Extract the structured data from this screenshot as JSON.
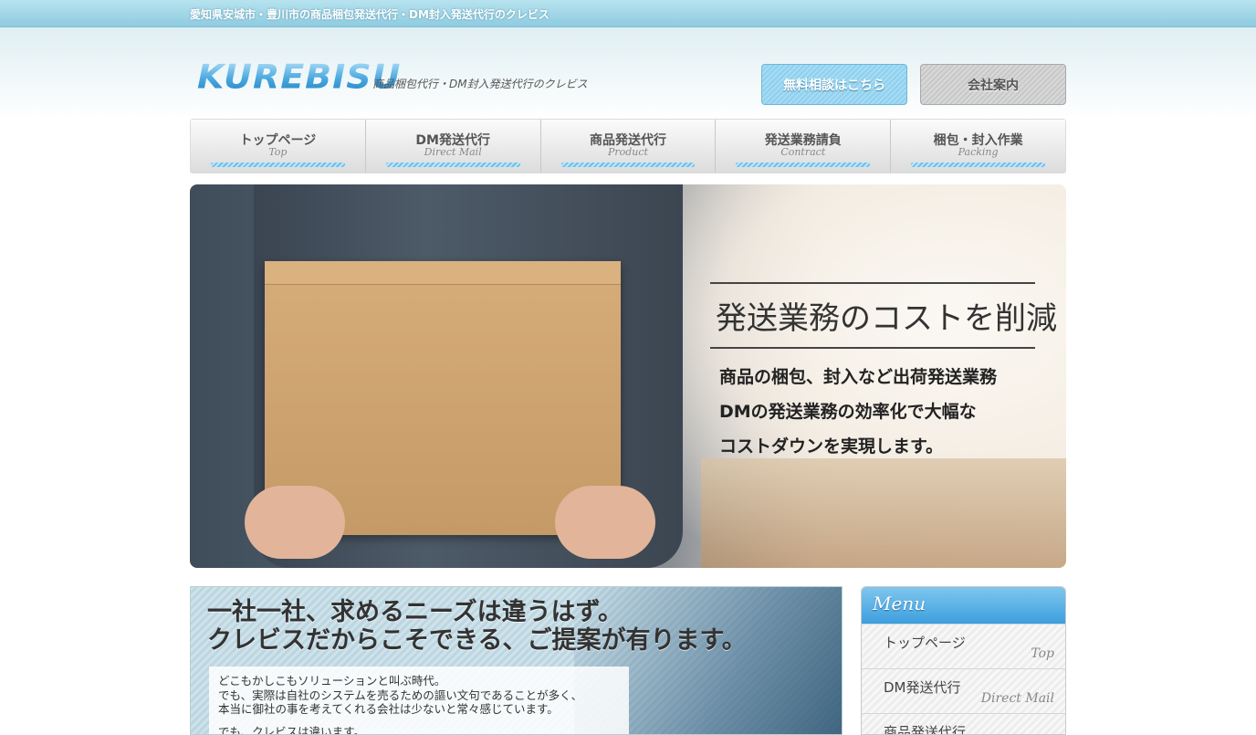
{
  "topbar": {
    "text": "愛知県安城市・豊川市の商品梱包発送代行・DM封入発送代行のクレビス"
  },
  "header": {
    "logo": "KUREBISU",
    "tagline": "商品梱包代行・DM封入発送代行のクレビス",
    "consult_button": "無料相談はこちら",
    "company_button": "会社案内"
  },
  "gnav": {
    "items": [
      {
        "label": "トップページ",
        "sub": "Top"
      },
      {
        "label": "DM発送代行",
        "sub": "Direct Mail"
      },
      {
        "label": "商品発送代行",
        "sub": "Product"
      },
      {
        "label": "発送業務請負",
        "sub": "Contract"
      },
      {
        "label": "梱包・封入作業",
        "sub": "Packing"
      }
    ]
  },
  "hero": {
    "title": "発送業務のコストを削減",
    "lines": [
      "商品の梱包、封入など出荷発送業務",
      "DMの発送業務の効率化で大幅な",
      "コストダウンを実現します。"
    ]
  },
  "intro": {
    "heading_line1": "一社一社、求めるニーズは違うはず。",
    "heading_line2": "クレビスだからこそできる、ご提案が有ります。",
    "body_line1": "どこもかしこもソリューションと叫ぶ時代。",
    "body_line2": "でも、実際は自社のシステムを売るための謳い文句であることが多く、",
    "body_line3": "本当に御社の事を考えてくれる会社は少ないと常々感じています。",
    "body_line4": "でも、クレビスは違います。"
  },
  "sidemenu": {
    "title": "Menu",
    "items": [
      {
        "label": "トップページ",
        "sub": "Top"
      },
      {
        "label": "DM発送代行",
        "sub": "Direct Mail"
      },
      {
        "label": "商品発送代行",
        "sub": ""
      }
    ]
  },
  "colors": {
    "accent": "#4aa8e0",
    "topbar": "#9fd6e8"
  }
}
